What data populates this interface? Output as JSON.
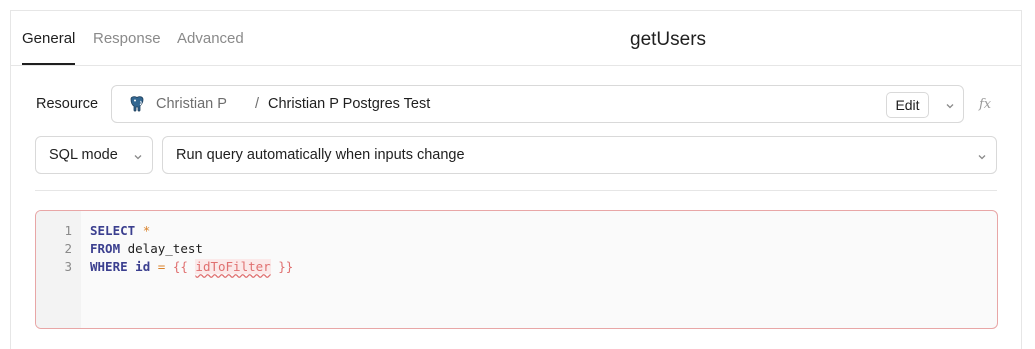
{
  "tabs": [
    {
      "label": "General",
      "active": true
    },
    {
      "label": "Response",
      "active": false
    },
    {
      "label": "Advanced",
      "active": false
    }
  ],
  "query_name": "getUsers",
  "resource": {
    "label": "Resource",
    "owner": "Christian P",
    "separator": "/",
    "name": "Christian P Postgres Test",
    "edit_label": "Edit",
    "icon": "postgres-elephant-icon",
    "fx_label": "fx"
  },
  "mode_select": {
    "value": "SQL mode"
  },
  "trigger_select": {
    "value": "Run query automatically when inputs change"
  },
  "editor": {
    "line_numbers": [
      "1",
      "2",
      "3"
    ],
    "lines": [
      [
        {
          "t": "SELECT",
          "c": "kw"
        },
        {
          "t": " ",
          "c": ""
        },
        {
          "t": "*",
          "c": "op"
        }
      ],
      [
        {
          "t": "FROM",
          "c": "kw"
        },
        {
          "t": " delay_test",
          "c": ""
        }
      ],
      [
        {
          "t": "WHERE",
          "c": "kw"
        },
        {
          "t": " ",
          "c": ""
        },
        {
          "t": "id",
          "c": "kw"
        },
        {
          "t": " ",
          "c": ""
        },
        {
          "t": "=",
          "c": "op"
        },
        {
          "t": " ",
          "c": ""
        },
        {
          "t": "{{",
          "c": "tmpl"
        },
        {
          "t": " ",
          "c": "tmpl"
        },
        {
          "t": "idToFilter",
          "c": "tmpl-var"
        },
        {
          "t": " ",
          "c": "tmpl"
        },
        {
          "t": "}}",
          "c": "tmpl"
        }
      ]
    ]
  },
  "colors": {
    "error_border": "#e8a6a6",
    "keyword": "#3b3f8f",
    "operator": "#d9822b",
    "template": "#e07070"
  }
}
